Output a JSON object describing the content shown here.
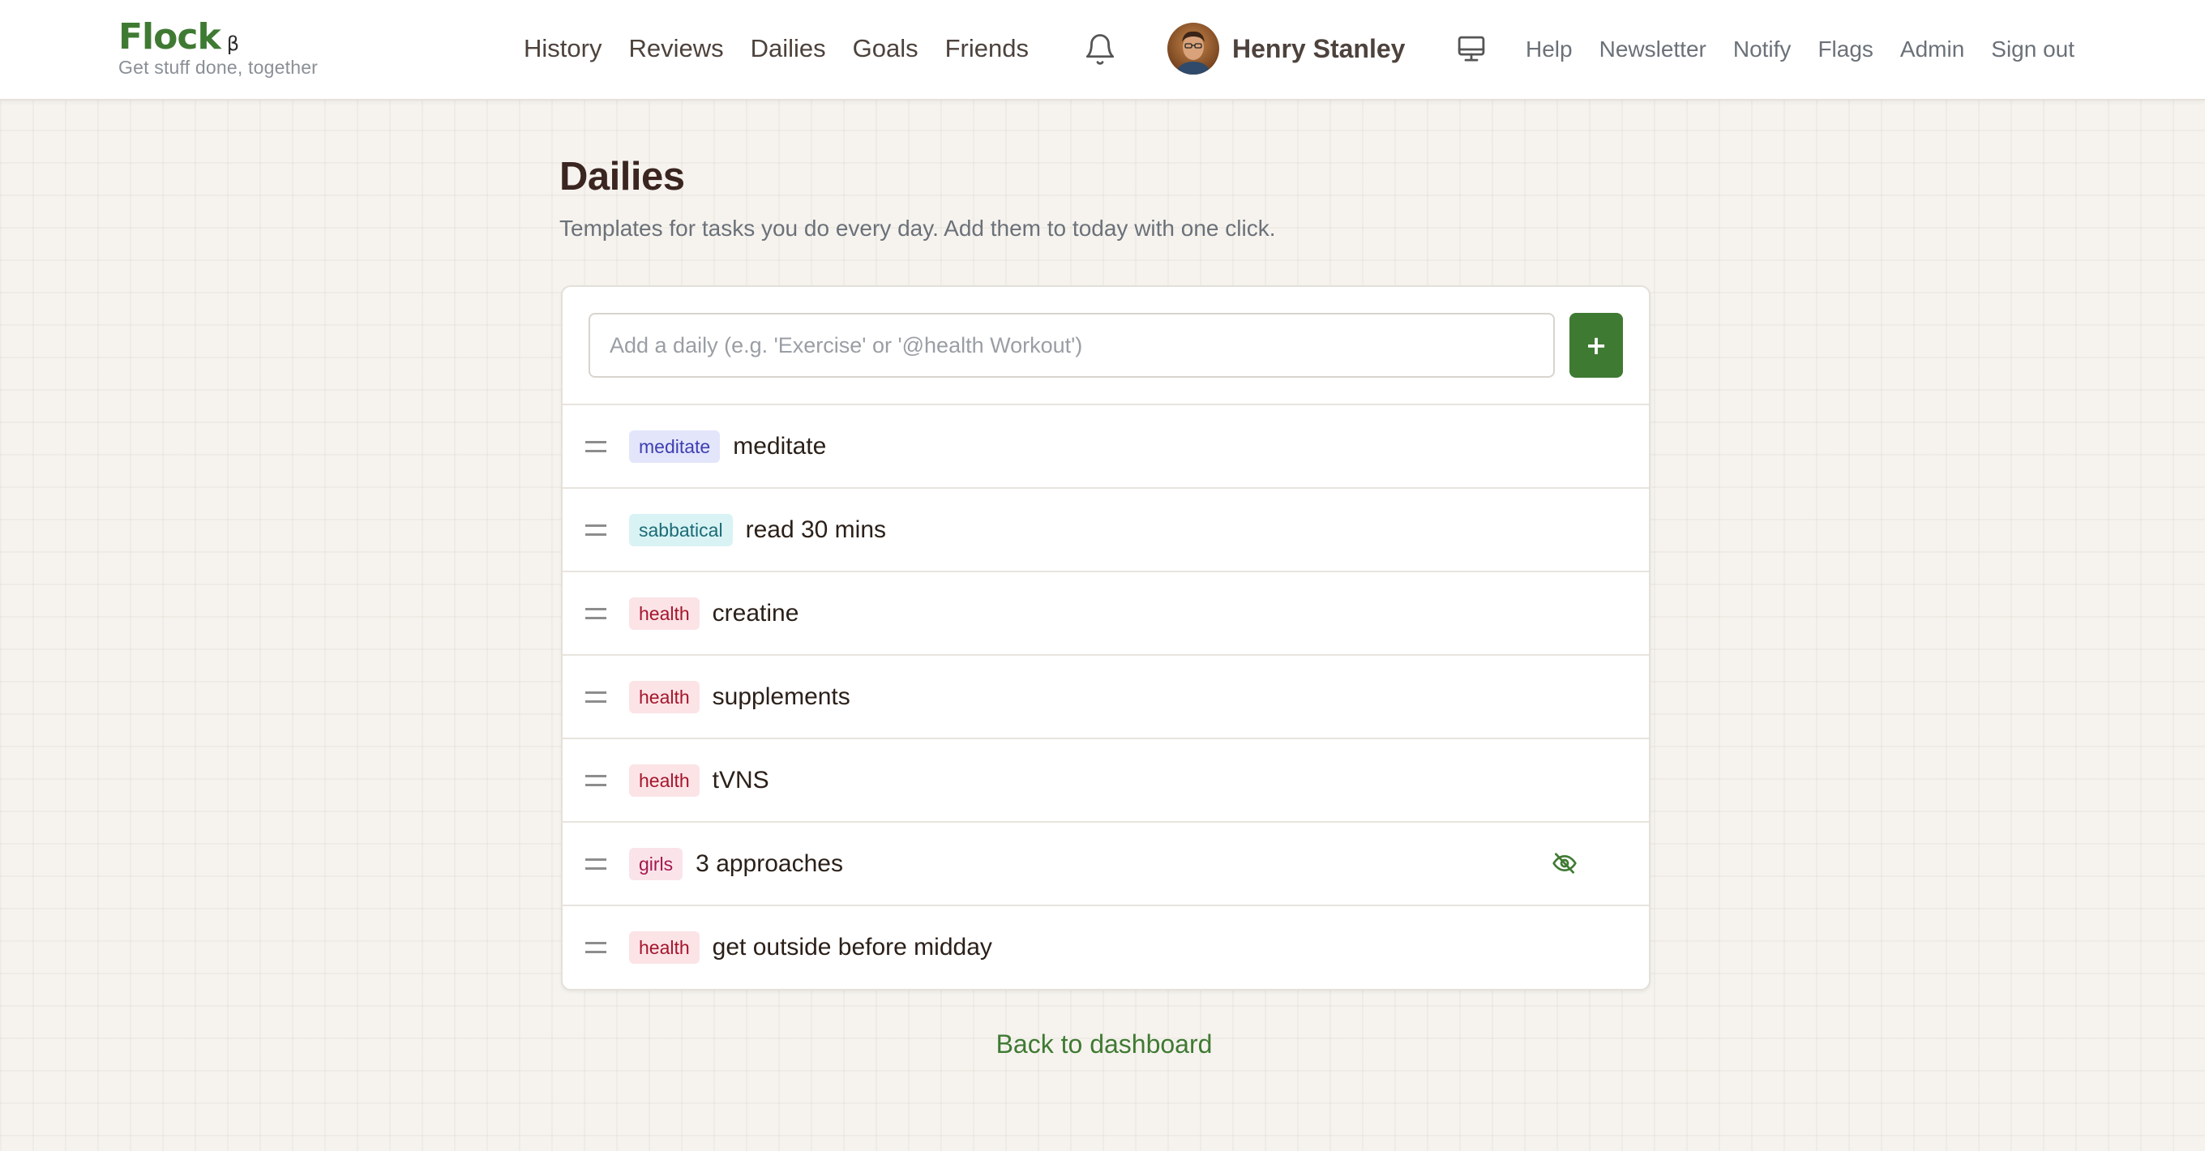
{
  "brand": {
    "name": "Flock",
    "beta": "β",
    "tagline": "Get stuff done, together"
  },
  "nav": {
    "primary": [
      "History",
      "Reviews",
      "Dailies",
      "Goals",
      "Friends"
    ],
    "secondary": [
      "Help",
      "Newsletter",
      "Notify",
      "Flags",
      "Admin",
      "Sign out"
    ]
  },
  "user": {
    "name": "Henry Stanley"
  },
  "icons": {
    "notifications": "bell-icon",
    "display": "monitor-icon",
    "hidden": "eye-off-icon",
    "drag": "drag-handle-icon",
    "add": "plus-icon"
  },
  "page": {
    "title": "Dailies",
    "subtitle": "Templates for tasks you do every day. Add them to today with one click."
  },
  "add_daily": {
    "placeholder": "Add a daily (e.g. 'Exercise' or '@health Workout')",
    "value": "",
    "button_label": "+"
  },
  "dailies": [
    {
      "tag": "meditate",
      "tag_style": "meditate",
      "text": "meditate",
      "hidden": false
    },
    {
      "tag": "sabbatical",
      "tag_style": "sabbatical",
      "text": "read 30 mins",
      "hidden": false
    },
    {
      "tag": "health",
      "tag_style": "health",
      "text": "creatine",
      "hidden": false
    },
    {
      "tag": "health",
      "tag_style": "health",
      "text": "supplements",
      "hidden": false
    },
    {
      "tag": "health",
      "tag_style": "health",
      "text": "tVNS",
      "hidden": false
    },
    {
      "tag": "girls",
      "tag_style": "girls",
      "text": "3 approaches",
      "hidden": true
    },
    {
      "tag": "health",
      "tag_style": "health",
      "text": "get outside before midday",
      "hidden": false
    }
  ],
  "footer": {
    "back_link": "Back to dashboard"
  },
  "colors": {
    "brand_green": "#3f7a33",
    "background": "#f6f3ee",
    "tag_meditate_bg": "#e3e5fb",
    "tag_sabbatical_bg": "#d9f3f5",
    "tag_health_bg": "#fbe3e6",
    "tag_girls_bg": "#fbe3ea"
  }
}
